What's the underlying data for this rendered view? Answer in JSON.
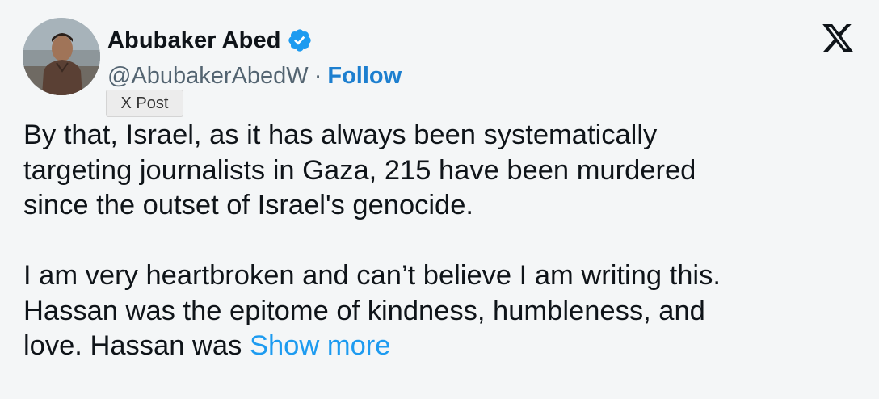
{
  "author": {
    "display_name": "Abubaker Abed",
    "handle": "@AbubakerAbedW",
    "separator": "·",
    "follow_label": "Follow",
    "verified_icon": "verified-badge-icon",
    "verified_color": "#1d9bf0"
  },
  "tooltip": {
    "label": "X Post"
  },
  "post": {
    "paragraph_1_lines": [
      "By that, Israel, as it has always been systematically",
      "targeting journalists in Gaza, 215 have been murdered",
      "since the outset of Israel's genocide."
    ],
    "paragraph_2_lines": [
      "I am very heartbroken and can’t believe I am writing this.",
      "Hassan was the epitome of kindness, humbleness, and",
      "love. Hassan was "
    ],
    "show_more_label": "Show more"
  },
  "brand": {
    "logo_icon": "x-logo-icon"
  },
  "colors": {
    "background": "#f4f6f7",
    "text": "#0f1419",
    "secondary_text": "#536471",
    "follow": "#1d7fcf",
    "link": "#1d9bf0"
  }
}
